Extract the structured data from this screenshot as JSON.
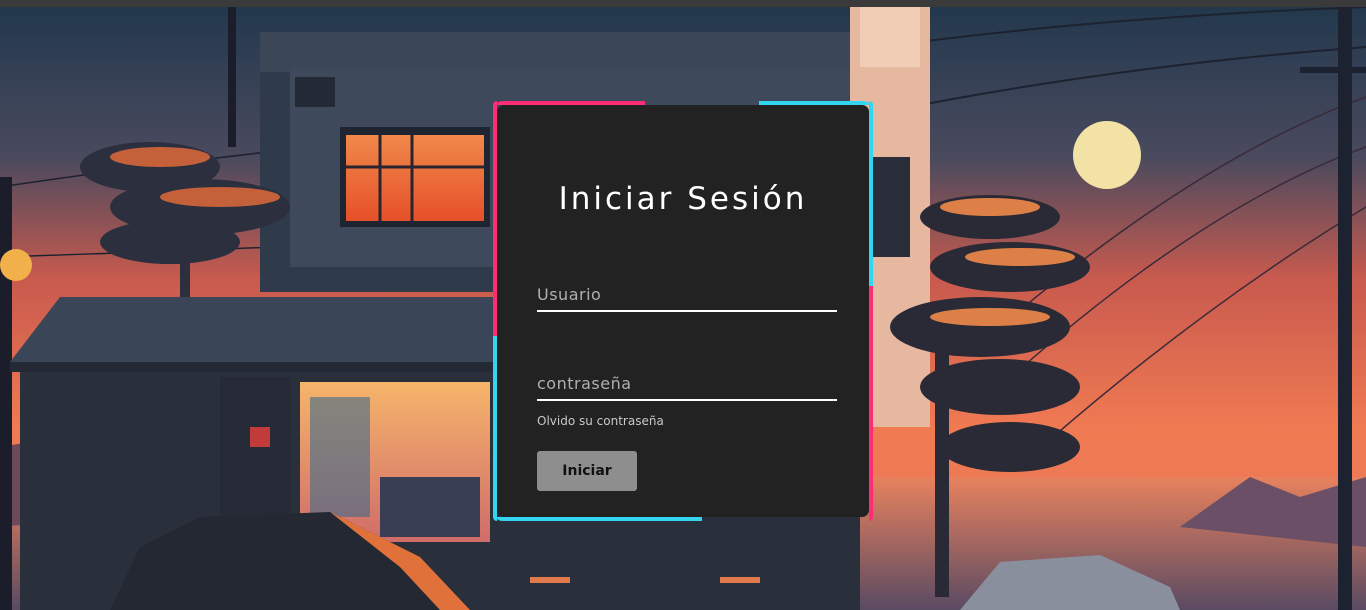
{
  "login": {
    "title": "Iniciar Sesión",
    "username_placeholder": "Usuario",
    "username_value": "",
    "password_placeholder": "contraseña",
    "password_value": "",
    "forgot_link": "Olvido su contraseña",
    "submit_label": "Iniciar"
  },
  "colors": {
    "card_background": "#222222",
    "accent_pink": "#ff2d75",
    "accent_cyan": "#33d6f0",
    "button_background": "#8e8e8e",
    "sky_top": "#2b3d52",
    "sky_bottom": "#f07850",
    "sun": "#f3e2a6"
  }
}
